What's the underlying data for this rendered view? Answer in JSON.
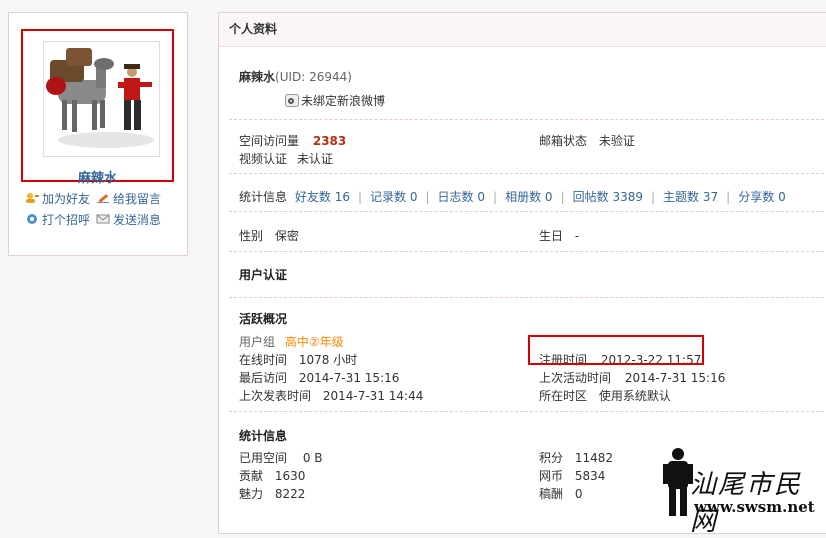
{
  "profile": {
    "username": "麻辣水",
    "uid_text": "(UID: 26944)",
    "weibo_text": "未绑定新浪微博"
  },
  "actions": {
    "add_friend": "加为好友",
    "leave_message": "给我留言",
    "greet": "打个招呼",
    "send_message": "发送消息"
  },
  "panel": {
    "title": "个人资料"
  },
  "basic": {
    "visits_label": "空间访问量",
    "visits_value": "2383",
    "email_label": "邮箱状态",
    "email_value": "未验证",
    "video_label": "视频认证",
    "video_value": "未认证"
  },
  "stats": {
    "label": "统计信息",
    "items": [
      {
        "label": "好友数",
        "value": "16"
      },
      {
        "label": "记录数",
        "value": "0"
      },
      {
        "label": "日志数",
        "value": "0"
      },
      {
        "label": "相册数",
        "value": "0"
      },
      {
        "label": "回帖数",
        "value": "3389"
      },
      {
        "label": "主题数",
        "value": "37"
      },
      {
        "label": "分享数",
        "value": "0"
      }
    ]
  },
  "personal": {
    "gender_label": "性别",
    "gender_value": "保密",
    "birthday_label": "生日",
    "birthday_value": "-"
  },
  "sections": {
    "user_auth": "用户认证",
    "activity": "活跃概况",
    "statistics": "统计信息"
  },
  "activity": {
    "group_label": "用户组",
    "group_value": "高中②年级",
    "online_label": "在线时间",
    "online_value": "1078 小时",
    "register_label": "注册时间",
    "register_value": "2012-3-22 11:57",
    "last_visit_label": "最后访问",
    "last_visit_value": "2014-7-31 15:16",
    "last_active_label": "上次活动时间",
    "last_active_value": "2014-7-31 15:16",
    "last_post_label": "上次发表时间",
    "last_post_value": "2014-7-31 14:44",
    "timezone_label": "所在时区",
    "timezone_value": "使用系统默认"
  },
  "statistics": {
    "space_label": "已用空间",
    "space_value": "0 B",
    "points_label": "积分",
    "points_value": "11482",
    "contrib_label": "贡献",
    "contrib_value": "1630",
    "coins_label": "网币",
    "coins_value": "5834",
    "charm_label": "魅力",
    "charm_value": "8222",
    "reward_label": "稿酬",
    "reward_value": "0"
  },
  "watermark": {
    "cn": "汕尾市民网",
    "url": "www.swsm.net"
  },
  "colors": {
    "highlight": "#d20000",
    "link": "#336699",
    "visits": "#b03010",
    "usergroup": "#ff8800"
  }
}
